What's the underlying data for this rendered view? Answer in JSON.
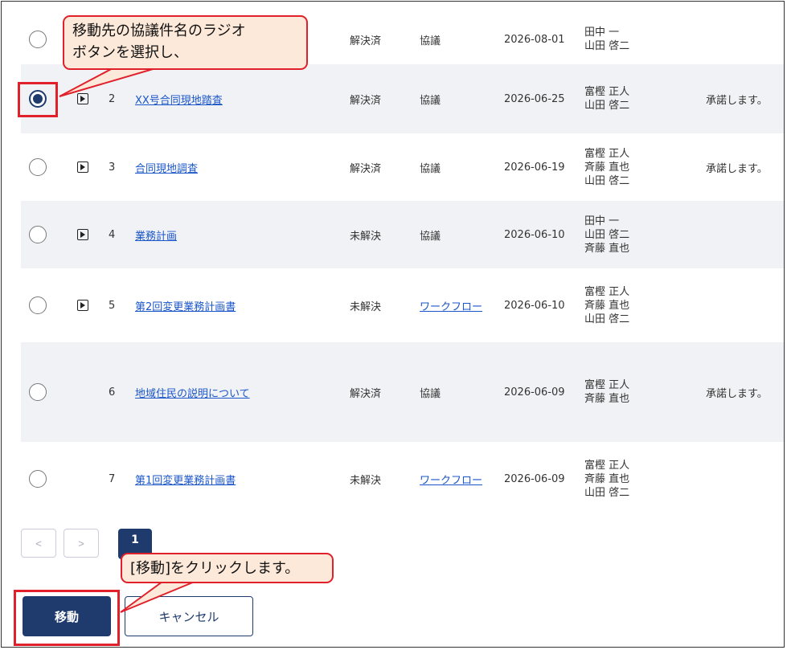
{
  "rows": [
    {
      "num": "",
      "title": "",
      "status": "解決済",
      "type": "協議",
      "type_is_link": false,
      "date": "2026-08-01",
      "persons": [
        "田中 一",
        "山田 啓二"
      ],
      "comment": "",
      "checked": false,
      "expandable": false
    },
    {
      "num": "2",
      "title": "XX号合同現地踏査",
      "status": "解決済",
      "type": "協議",
      "type_is_link": false,
      "date": "2026-06-25",
      "persons": [
        "富樫 正人",
        "山田 啓二"
      ],
      "comment": "承諾します。",
      "checked": true,
      "expandable": true
    },
    {
      "num": "3",
      "title": "合同現地調査",
      "status": "解決済",
      "type": "協議",
      "type_is_link": false,
      "date": "2026-06-19",
      "persons": [
        "富樫 正人",
        "斉藤 直也",
        "山田 啓二"
      ],
      "comment": "承諾します。",
      "checked": false,
      "expandable": true
    },
    {
      "num": "4",
      "title": "業務計画",
      "status": "未解決",
      "type": "協議",
      "type_is_link": false,
      "date": "2026-06-10",
      "persons": [
        "田中 一",
        "山田 啓二",
        "斉藤 直也"
      ],
      "comment": "",
      "checked": false,
      "expandable": true
    },
    {
      "num": "5",
      "title": "第2回変更業務計画書",
      "status": "未解決",
      "type": "ワークフロー",
      "type_is_link": true,
      "date": "2026-06-10",
      "persons": [
        "富樫 正人",
        "斉藤 直也",
        "山田 啓二"
      ],
      "comment": "",
      "checked": false,
      "expandable": true
    },
    {
      "num": "6",
      "title": "地域住民の説明について",
      "status": "解決済",
      "type": "協議",
      "type_is_link": false,
      "date": "2026-06-09",
      "persons": [
        "富樫 正人",
        "斉藤 直也"
      ],
      "comment": "承諾します。",
      "checked": false,
      "expandable": false
    },
    {
      "num": "7",
      "title": "第1回変更業務計画書",
      "status": "未解決",
      "type": "ワークフロー",
      "type_is_link": true,
      "date": "2026-06-09",
      "persons": [
        "富樫 正人",
        "斉藤 直也",
        "山田 啓二"
      ],
      "comment": "",
      "checked": false,
      "expandable": false
    }
  ],
  "pagination": {
    "prev": "<",
    "next": ">",
    "current": "1"
  },
  "buttons": {
    "move": "移動",
    "cancel": "キャンセル"
  },
  "callouts": {
    "select_line1": "移動先の協議件名のラジオ",
    "select_line2": "ボタンを選択し、",
    "click_move": "[移動]をクリックします。"
  },
  "colors": {
    "accent": "#1f3b6e",
    "link": "#1a56c9",
    "highlight": "#e0202a",
    "callout_bg": "#fde9d9",
    "row_alt": "#f1f2f5"
  }
}
